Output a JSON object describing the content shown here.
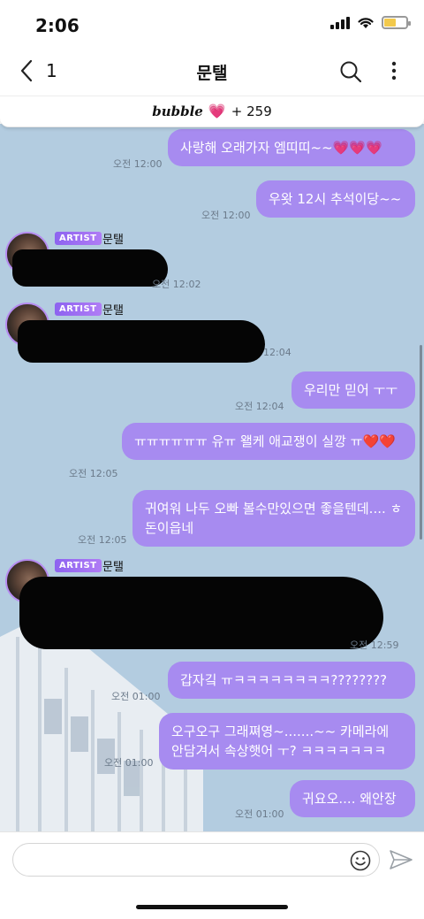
{
  "status": {
    "time": "2:06"
  },
  "nav": {
    "back_count": "1",
    "title": "문탤"
  },
  "bubble_bar": {
    "logo": "bubble",
    "heart": "💗",
    "plus": "+ 259"
  },
  "messages": [
    {
      "text": "사랑해 오래가자 엠띠띠~~💗💗💗",
      "time": "오전 12:00"
    },
    {
      "text": "우왓 12시 추석이당~~",
      "time": "오전 12:00"
    },
    {
      "text": "우리만 믿어 ㅜㅜ",
      "time": "오전 12:04"
    },
    {
      "text": "ㅠㅠㅠㅠㅠㅠ 유ㅠ 왤케 애교쟁이 실깡 ㅠ❤️❤️",
      "time": "오전 12:05"
    },
    {
      "text": "귀여워 나두 오빠 볼수만있으면 좋을텐데.... ㅎ 돈이읍네",
      "time": "오전 12:05"
    },
    {
      "text": "갑자깈 ㅠㅋㅋㅋㅋㅋㅋㅋㅋ????????",
      "time": "오전 01:00"
    },
    {
      "text": "오구오구 그래쪄영~.......~~ 카메라에 안담겨서 속상햇어 ㅜ? ㅋㅋㅋㅋㅋㅋㅋ",
      "time": "오전 01:00"
    },
    {
      "text": "귀요오.... 왜안장",
      "time": "오전 01:00"
    }
  ],
  "artist_messages": [
    {
      "badge": "ARTIST",
      "name": "문탤",
      "time": "오전 12:02"
    },
    {
      "badge": "ARTIST",
      "name": "문탤",
      "time": "12:04"
    },
    {
      "badge": "ARTIST",
      "name": "문탤",
      "time": "오전 12:59"
    }
  ],
  "input": {
    "placeholder": "",
    "value": ""
  },
  "icons": {
    "back": "chevron-left-icon",
    "search": "search-icon",
    "more": "more-vertical-icon",
    "emoji": "smile-icon",
    "send": "send-icon"
  },
  "colors": {
    "fan_bubble": "#a78bf0",
    "chat_bg": "#b3cce0",
    "artist_badge": "#8d63f0"
  }
}
